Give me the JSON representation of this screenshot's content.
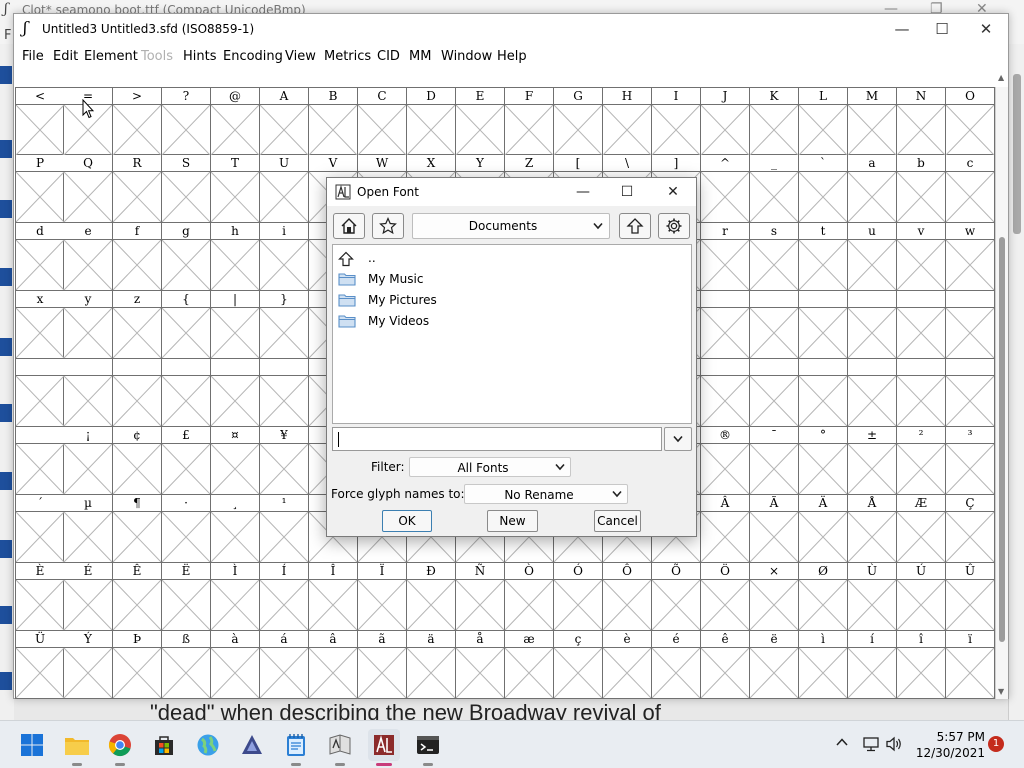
{
  "background_window": {
    "title": "Clot* seamono boot.ttf (Compact UnicodeBmp)",
    "menu_first": "F",
    "controls": {
      "min": "—",
      "max": "❐",
      "close": "✕"
    }
  },
  "main_window": {
    "title": "Untitled3  Untitled3.sfd (ISO8859-1)",
    "controls": {
      "min": "—",
      "max": "☐",
      "close": "✕"
    },
    "menu": {
      "file": "File",
      "edit": "Edit",
      "element": "Element",
      "tools": "Tools",
      "hints": "Hints",
      "encoding": "Encoding",
      "view": "View",
      "metrics": "Metrics",
      "cid": "CID",
      "mm": "MM",
      "window": "Window",
      "help": "Help"
    },
    "glyph_rows": [
      [
        "<",
        "=",
        ">",
        "?",
        "@",
        "A",
        "B",
        "C",
        "D",
        "E",
        "F",
        "G",
        "H",
        "I",
        "J",
        "K",
        "L",
        "M",
        "N",
        "O"
      ],
      [
        "P",
        "Q",
        "R",
        "S",
        "T",
        "U",
        "V",
        "W",
        "X",
        "Y",
        "Z",
        "[",
        "\\",
        "]",
        "^",
        "_",
        "`",
        "a",
        "b",
        "c"
      ],
      [
        "d",
        "e",
        "f",
        "g",
        "h",
        "i",
        "",
        "",
        "",
        "",
        "",
        "",
        "",
        "",
        "r",
        "s",
        "t",
        "u",
        "v",
        "w"
      ],
      [
        "x",
        "y",
        "z",
        "{",
        "|",
        "}",
        "",
        "",
        "",
        "",
        "",
        "",
        "",
        "",
        "",
        "",
        "",
        "",
        "",
        ""
      ],
      [
        "",
        "",
        "",
        "",
        "",
        "",
        "",
        "",
        "",
        "",
        "",
        "",
        "",
        "",
        "",
        "",
        "",
        "",
        "",
        ""
      ],
      [
        "",
        "¡",
        "¢",
        "£",
        "¤",
        "¥",
        "",
        "",
        "",
        "",
        "",
        "",
        "",
        "",
        "®",
        "¯",
        "°",
        "±",
        "²",
        "³"
      ],
      [
        "´",
        "µ",
        "¶",
        "·",
        "¸",
        "¹",
        "",
        "",
        "",
        "",
        "",
        "",
        "",
        "",
        "Â",
        "Ã",
        "Ä",
        "Å",
        "Æ",
        "Ç"
      ],
      [
        "È",
        "É",
        "Ê",
        "Ë",
        "Ì",
        "Í",
        "Î",
        "Ï",
        "Ð",
        "Ñ",
        "Ò",
        "Ó",
        "Ô",
        "Õ",
        "Ö",
        "×",
        "Ø",
        "Ù",
        "Ú",
        "Û"
      ],
      [
        "Ü",
        "Ý",
        "Þ",
        "ß",
        "à",
        "á",
        "â",
        "ã",
        "ä",
        "å",
        "æ",
        "ç",
        "è",
        "é",
        "ê",
        "ë",
        "ì",
        "í",
        "î",
        "ï"
      ]
    ]
  },
  "dialog": {
    "title": "Open Font",
    "controls": {
      "min": "—",
      "max": "☐",
      "close": "✕"
    },
    "directory": "Documents",
    "files": [
      {
        "name": "..",
        "icon": "up-arrow-icon"
      },
      {
        "name": "My Music",
        "icon": "folder-icon"
      },
      {
        "name": "My Pictures",
        "icon": "folder-icon"
      },
      {
        "name": "My Videos",
        "icon": "folder-icon"
      }
    ],
    "filename_value": "",
    "filter_label": "Filter:",
    "filter_value": "All Fonts",
    "force_label": "Force glyph names to:",
    "force_value": "No Rename",
    "ok": "OK",
    "new": "New",
    "cancel": "Cancel"
  },
  "background_text": "\"dead\" when describing the new Broadway revival of",
  "taskbar": {
    "time": "5:57 PM",
    "date": "12/30/2021",
    "notifications": "1"
  },
  "colors": {
    "accent": "#3c7fb1",
    "folder": "#5a8fc8",
    "badge": "#c42b1c"
  }
}
